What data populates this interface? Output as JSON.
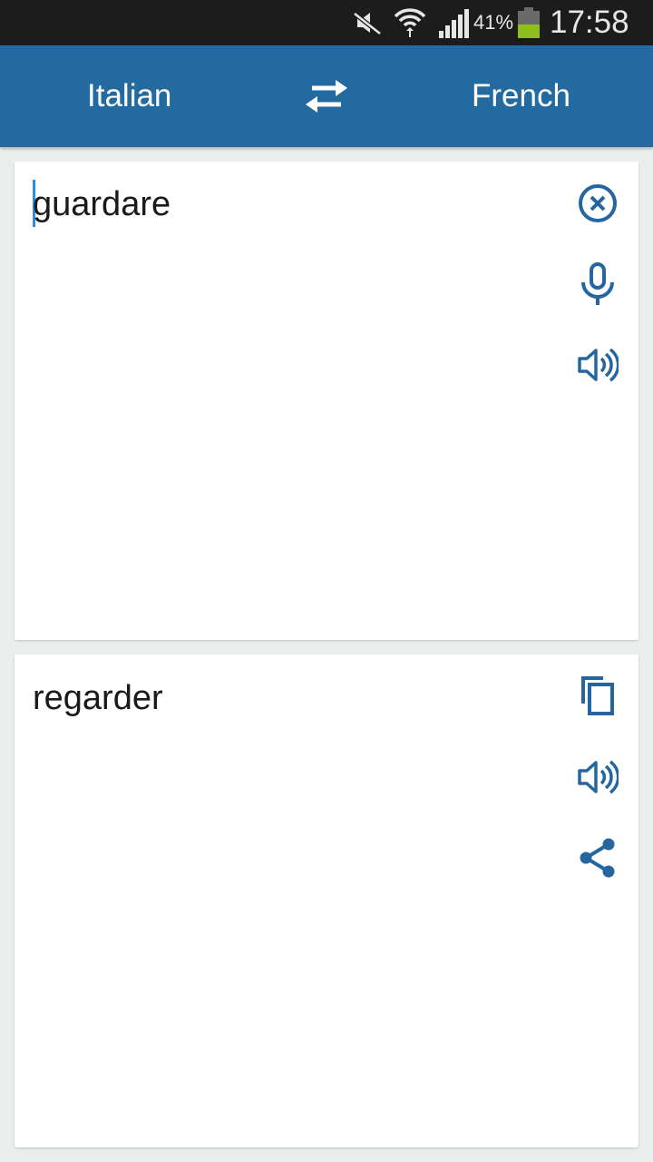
{
  "status_bar": {
    "battery_percent": "41%",
    "time": "17:58",
    "icons": [
      "mute-icon",
      "wifi-icon",
      "signal-icon",
      "battery-icon"
    ]
  },
  "toolbar": {
    "source_language": "Italian",
    "target_language": "French",
    "swap_icon": "swap-arrows-icon"
  },
  "input_card": {
    "text": "guardare",
    "icons": [
      "clear-icon",
      "microphone-icon",
      "speaker-icon"
    ]
  },
  "output_card": {
    "text": "regarder",
    "icons": [
      "copy-icon",
      "speaker-icon",
      "share-icon"
    ]
  },
  "colors": {
    "app_bar": "#236aa0",
    "icon_blue": "#2566a0",
    "status_bar": "#1c1c1c",
    "background": "#e9edec",
    "cursor": "#2a8ee5",
    "battery_fill": "#8fbf1e"
  }
}
